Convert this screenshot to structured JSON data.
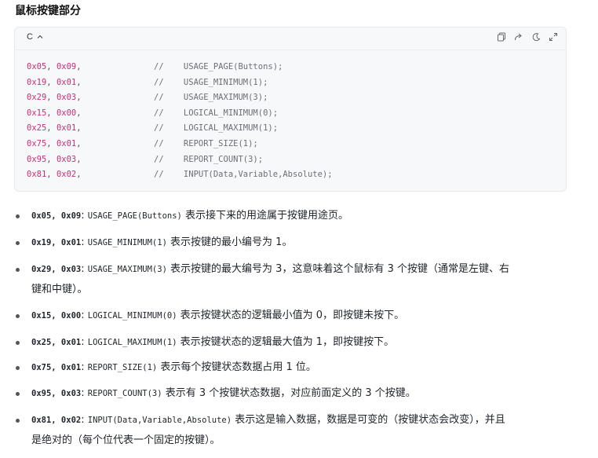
{
  "heading": "鼠标按键部分",
  "code_block": {
    "language": "C",
    "icons": [
      "copy-icon",
      "share-icon",
      "theme-icon",
      "expand-icon"
    ],
    "lines": [
      {
        "a": "0x05",
        "b": "0x09",
        "comment": "//    USAGE_PAGE(Buttons);"
      },
      {
        "a": "0x19",
        "b": "0x01",
        "comment": "//    USAGE_MINIMUM(1);"
      },
      {
        "a": "0x29",
        "b": "0x03",
        "comment": "//    USAGE_MAXIMUM(3);"
      },
      {
        "a": "0x15",
        "b": "0x00",
        "comment": "//    LOGICAL_MINIMUM(0);"
      },
      {
        "a": "0x25",
        "b": "0x01",
        "comment": "//    LOGICAL_MAXIMUM(1);"
      },
      {
        "a": "0x75",
        "b": "0x01",
        "comment": "//    REPORT_SIZE(1);"
      },
      {
        "a": "0x95",
        "b": "0x03",
        "comment": "//    REPORT_COUNT(3);"
      },
      {
        "a": "0x81",
        "b": "0x02",
        "comment": "//    INPUT(Data,Variable,Absolute);"
      }
    ]
  },
  "list": [
    {
      "bytes": "0x05, 0x09",
      "sep": ":",
      "macro": "USAGE_PAGE(Buttons)",
      "desc": " 表示接下来的用途属于按键用途页。"
    },
    {
      "bytes": "0x19, 0x01",
      "sep": ":",
      "macro": "USAGE_MINIMUM(1)",
      "desc": " 表示按键的最小编号为 1。"
    },
    {
      "bytes": "0x29, 0x03",
      "sep": ":",
      "macro": "USAGE_MAXIMUM(3)",
      "desc": " 表示按键的最大编号为 3，这意味着这个鼠标有 3 个按键（通常是左键、右",
      "desc2": "键和中键）。"
    },
    {
      "bytes": "0x15, 0x00",
      "sep": ":",
      "macro": "LOGICAL_MINIMUM(0)",
      "desc": " 表示按键状态的逻辑最小值为 0，即按键未按下。"
    },
    {
      "bytes": "0x25, 0x01",
      "sep": ":",
      "macro": "LOGICAL_MAXIMUM(1)",
      "desc": " 表示按键状态的逻辑最大值为 1，即按键按下。"
    },
    {
      "bytes": "0x75, 0x01",
      "sep": ":",
      "macro": "REPORT_SIZE(1)",
      "desc": " 表示每个按键状态数据占用 1 位。"
    },
    {
      "bytes": "0x95, 0x03",
      "sep": ":",
      "macro": "REPORT_COUNT(3)",
      "desc": " 表示有 3 个按键状态数据，对应前面定义的 3 个按键。"
    },
    {
      "bytes": "0x81, 0x02",
      "sep": ":",
      "macro": "INPUT(Data,Variable,Absolute)",
      "desc": " 表示这是输入数据，数据是可变的（按键状态会改变），并且",
      "desc2": "是绝对的（每个位代表一个固定的按键）。"
    }
  ]
}
